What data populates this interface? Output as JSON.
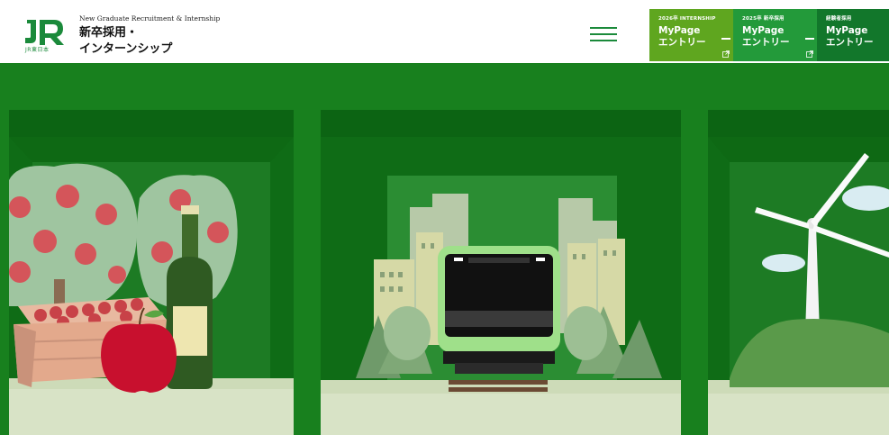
{
  "header": {
    "logo_text": "JR",
    "logo_sub": "JR東日本",
    "site_eng": "New Graduate Recruitment & Internship",
    "site_jp_line1": "新卒採用・",
    "site_jp_line2": "インターンシップ",
    "menu_icon": "hamburger-menu-icon"
  },
  "entries": [
    {
      "top": "2026卒 INTERNSHIP",
      "mypage": "MyPage",
      "entry": "エントリー",
      "color": "#5fa61f",
      "external": true
    },
    {
      "top": "2025卒 新卒採用",
      "mypage": "MyPage",
      "entry": "エントリー",
      "color": "#239a3a",
      "external": true
    },
    {
      "top": "経験者採用",
      "mypage": "MyPage",
      "entry": "エントリー",
      "color": "#12772b",
      "external": false
    }
  ],
  "colors": {
    "brand_green": "#1b8a3b",
    "hero_background": "#18801e"
  }
}
